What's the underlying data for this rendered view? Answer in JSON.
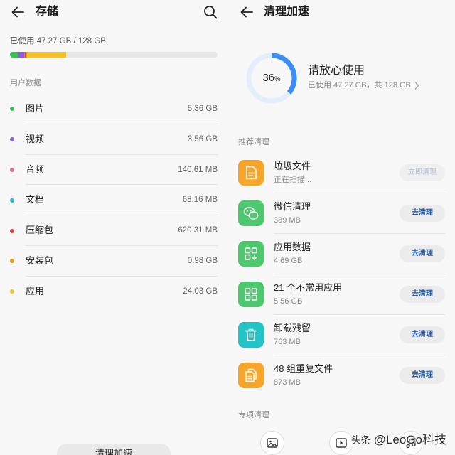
{
  "storage": {
    "title": "存储",
    "back_icon": "back-arrow-icon",
    "search_icon": "search-icon",
    "used_text": "已使用 47.27 GB / 128 GB",
    "section_label": "用户数据",
    "items": [
      {
        "label": "图片",
        "value": "5.36 GB",
        "color": "#36c253"
      },
      {
        "label": "视频",
        "value": "3.56 GB",
        "color": "#8d5bd9"
      },
      {
        "label": "音频",
        "value": "140.61 MB",
        "color": "#e8689b"
      },
      {
        "label": "文档",
        "value": "68.16 MB",
        "color": "#2ab8d3"
      },
      {
        "label": "压缩包",
        "value": "620.31 MB",
        "color": "#df3e3e"
      },
      {
        "label": "安装包",
        "value": "0.98 GB",
        "color": "#f09a1a"
      },
      {
        "label": "应用",
        "value": "24.03 GB",
        "color": "#f5c12b"
      }
    ],
    "bottom_button": "清理加速"
  },
  "cleanup": {
    "title": "清理加速",
    "back_icon": "back-arrow-icon",
    "ring": {
      "percent": "36",
      "unit": "%",
      "color": "#3a8ef6",
      "track_color": "#e3edfb"
    },
    "status_title": "请放心使用",
    "status_detail": "已使用 47.27 GB，共 128 GB",
    "section_recommended": "推荐清理",
    "items": [
      {
        "title": "垃圾文件",
        "subtitle": "正在扫描...",
        "button": "立即清理",
        "icon": "document-icon",
        "color": "#f7a52a",
        "disabled": true
      },
      {
        "title": "微信清理",
        "subtitle": "389 MB",
        "button": "去清理",
        "icon": "wechat-icon",
        "color": "#4dc86e",
        "disabled": false
      },
      {
        "title": "应用数据",
        "subtitle": "4.69 GB",
        "button": "去清理",
        "icon": "app-data-icon",
        "color": "#4dc86e",
        "disabled": false
      },
      {
        "title": "21 个不常用应用",
        "subtitle": "5.56 GB",
        "button": "去清理",
        "icon": "app-grid-icon",
        "color": "#4dc86e",
        "disabled": false
      },
      {
        "title": "卸载残留",
        "subtitle": "763 MB",
        "button": "去清理",
        "icon": "trash-icon",
        "color": "#23c4c6",
        "disabled": false
      },
      {
        "title": "48 组重复文件",
        "subtitle": "873 MB",
        "button": "去清理",
        "icon": "duplicate-files-icon",
        "color": "#f7a52a",
        "disabled": false
      }
    ],
    "section_special": "专项清理",
    "special_items": [
      {
        "icon": "image-icon"
      },
      {
        "icon": "video-icon"
      },
      {
        "icon": "music-icon"
      }
    ]
  },
  "watermark": {
    "prefix": "头条",
    "handle": "@LeoGo科技"
  }
}
